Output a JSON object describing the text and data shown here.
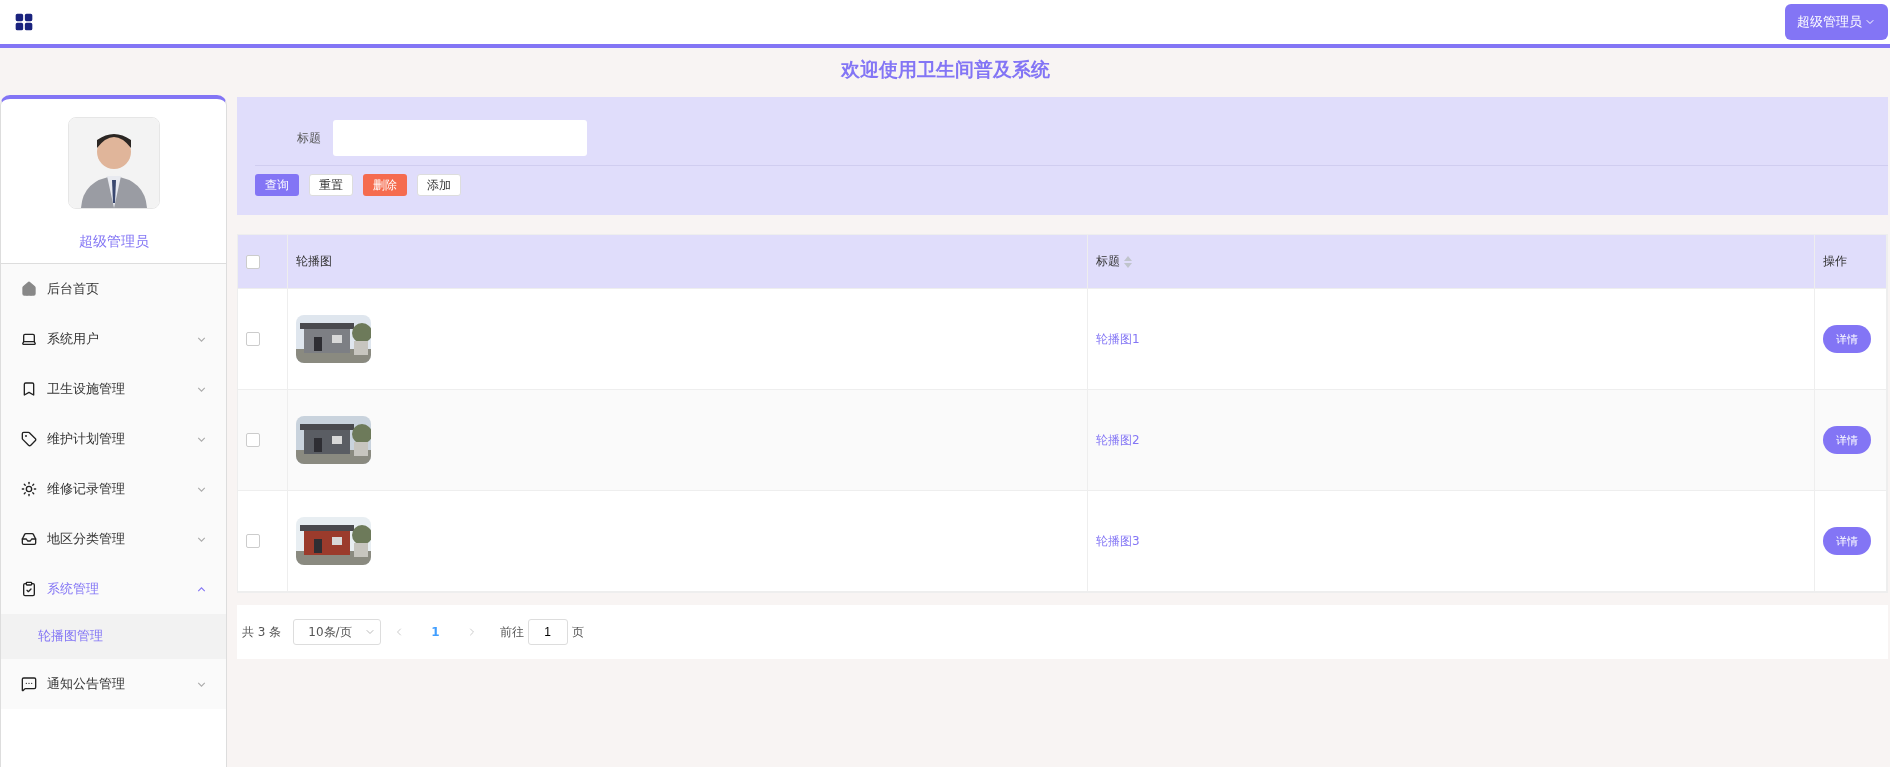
{
  "header": {
    "user_menu": "超级管理员"
  },
  "page_title": "欢迎使用卫生间普及系统",
  "sidebar": {
    "user_name": "超级管理员",
    "items": [
      {
        "label": "后台首页",
        "selected": false
      },
      {
        "label": "系统用户",
        "expanded": false,
        "selected": false
      },
      {
        "label": "卫生设施管理",
        "expanded": false,
        "selected": false
      },
      {
        "label": "维护计划管理",
        "expanded": false,
        "selected": false
      },
      {
        "label": "维修记录管理",
        "expanded": false,
        "selected": false
      },
      {
        "label": "地区分类管理",
        "expanded": false,
        "selected": false
      },
      {
        "label": "系统管理",
        "expanded": true,
        "selected": true,
        "children": [
          {
            "label": "轮播图管理",
            "selected": true
          }
        ]
      },
      {
        "label": "通知公告管理",
        "expanded": false,
        "selected": false
      }
    ]
  },
  "search": {
    "label": "标题",
    "buttons": [
      {
        "label": "查询",
        "kind": "primary"
      },
      {
        "label": "重置",
        "kind": "plain"
      },
      {
        "label": "删除",
        "kind": "danger"
      },
      {
        "label": "添加",
        "kind": "plain"
      }
    ]
  },
  "table": {
    "all_checked": false,
    "columns": [
      "轮播图",
      "标题",
      "操作"
    ],
    "rows": [
      {
        "checked": false,
        "title": "轮播图1",
        "action": "详情"
      },
      {
        "checked": false,
        "title": "轮播图2",
        "action": "详情"
      },
      {
        "checked": false,
        "title": "轮播图3",
        "action": "详情"
      }
    ]
  },
  "pagination": {
    "total": "共 3 条",
    "page_size": "10条/页",
    "current_page": "1",
    "goto_label": "前往",
    "goto_value": "1",
    "goto_suffix": "页"
  }
}
